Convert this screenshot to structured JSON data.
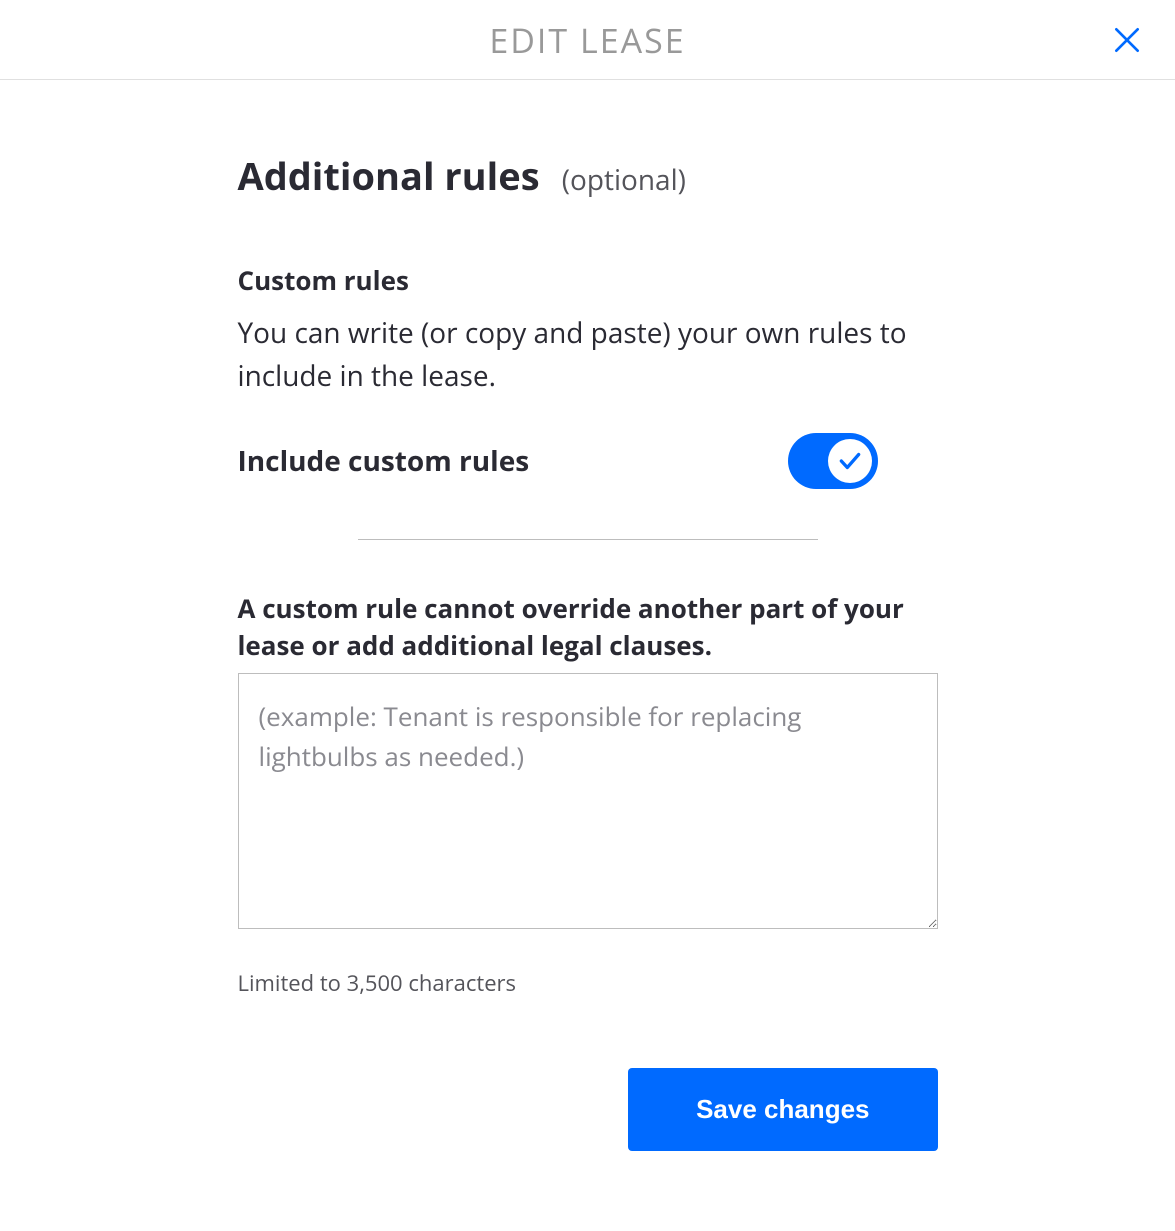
{
  "header": {
    "title": "EDIT LEASE"
  },
  "section": {
    "title": "Additional rules",
    "optional_tag": "(optional)"
  },
  "custom_rules": {
    "heading": "Custom rules",
    "description": "You can write (or copy and paste) your own rules to include in the lease.",
    "toggle_label": "Include custom rules",
    "toggle_on": true,
    "warning": "A custom rule cannot override another part of your lease or add additional legal clauses.",
    "textarea_value": "",
    "textarea_placeholder": "(example: Tenant is responsible for replacing lightbulbs as needed.)",
    "char_limit_note": "Limited to 3,500 characters"
  },
  "actions": {
    "save_label": "Save changes"
  },
  "colors": {
    "accent": "#006aff"
  }
}
